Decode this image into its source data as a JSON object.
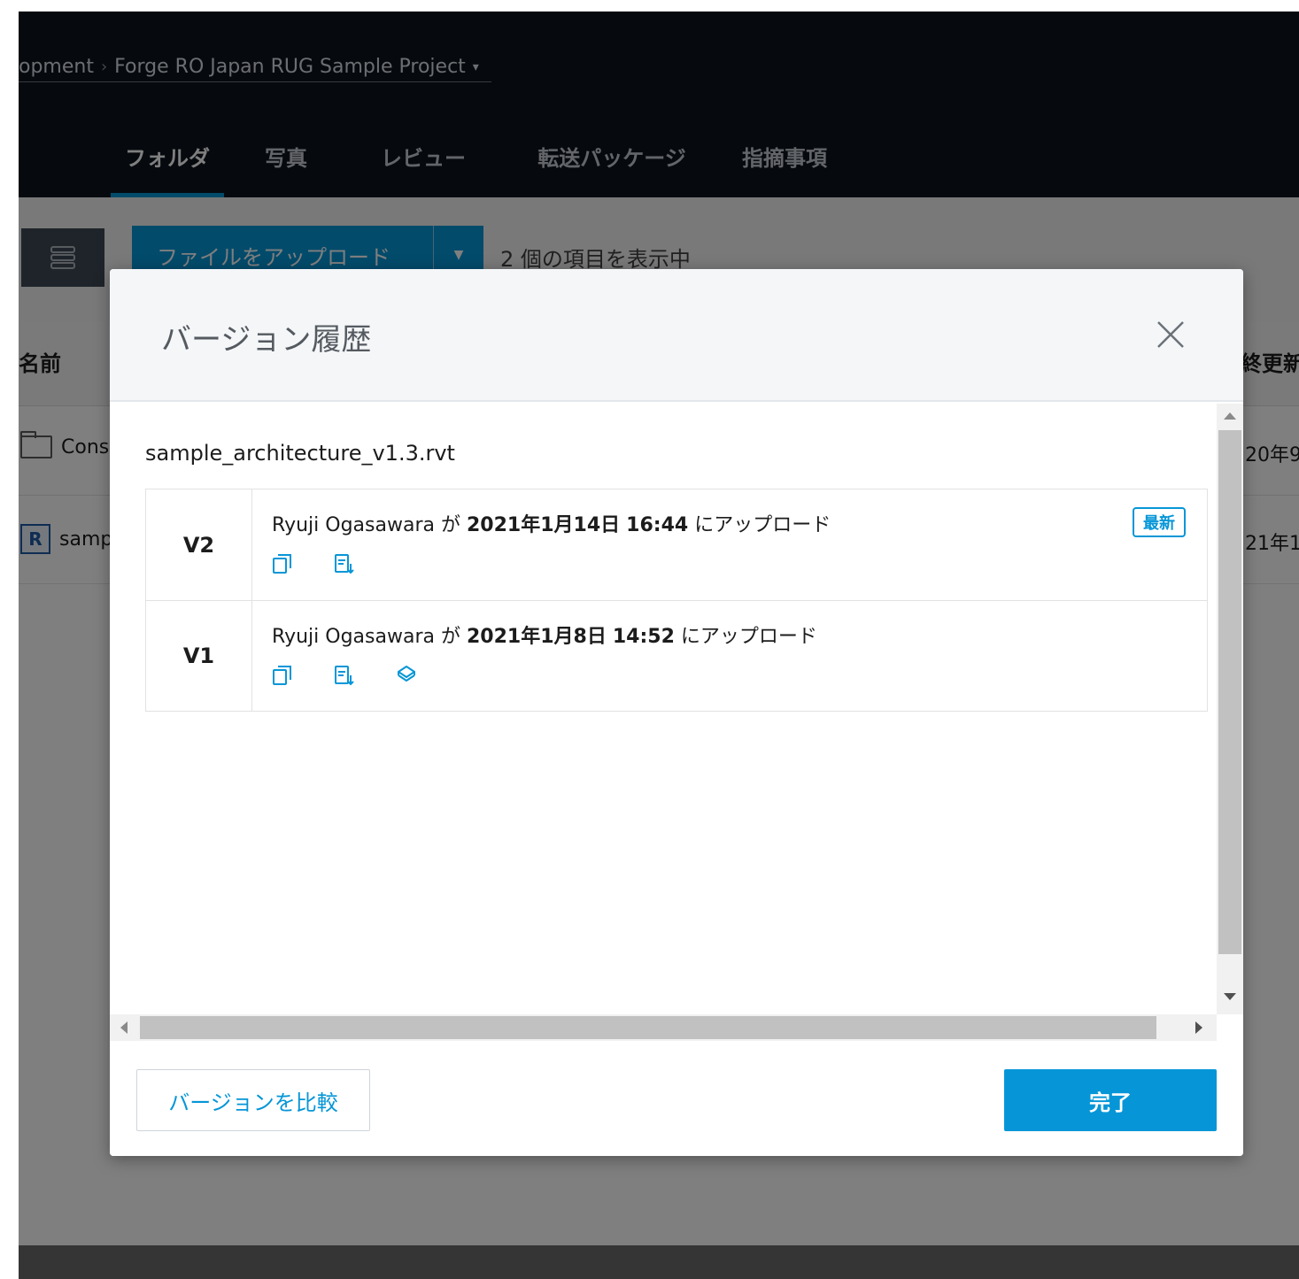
{
  "header": {
    "breadcrumb": {
      "parent": "opment",
      "separator": "›",
      "project": "Forge RO Japan RUG Sample Project",
      "caret": "▾"
    },
    "tabs": [
      {
        "label": "フォルダ",
        "active": true
      },
      {
        "label": "写真"
      },
      {
        "label": "レビュー"
      },
      {
        "label": "転送パッケージ"
      },
      {
        "label": "指摘事項"
      }
    ]
  },
  "toolbar": {
    "upload_label": "ファイルをアップロード",
    "count_text": "2 個の項目を表示中"
  },
  "table": {
    "col_name": "名前",
    "col_modified": "終更新",
    "rows": [
      {
        "name": "Cons",
        "date": "20年9",
        "icon": "folder-icon"
      },
      {
        "name": "samp",
        "date": "21年1/",
        "icon": "revit-file-icon"
      }
    ]
  },
  "modal": {
    "title": "バージョン履歴",
    "file_name": "sample_architecture_v1.3.rvt",
    "versions": [
      {
        "label": "V2",
        "user": "Ryuji Ogasawara",
        "by": "が",
        "date": "2021年1月14日",
        "time": "16:44",
        "suffix": "にアップロード",
        "badge": "最新",
        "actions": [
          "copy-icon",
          "details-icon"
        ]
      },
      {
        "label": "V1",
        "user": "Ryuji Ogasawara",
        "by": "が",
        "date": "2021年1月8日",
        "time": "14:52",
        "suffix": "にアップロード",
        "actions": [
          "copy-icon",
          "details-icon",
          "layers-icon"
        ]
      }
    ],
    "compare_button": "バージョンを比較",
    "done_button": "完了"
  },
  "colors": {
    "accent": "#0696d7",
    "topbar": "#0d141f",
    "overlay": "rgba(0,0,0,0.5)"
  }
}
